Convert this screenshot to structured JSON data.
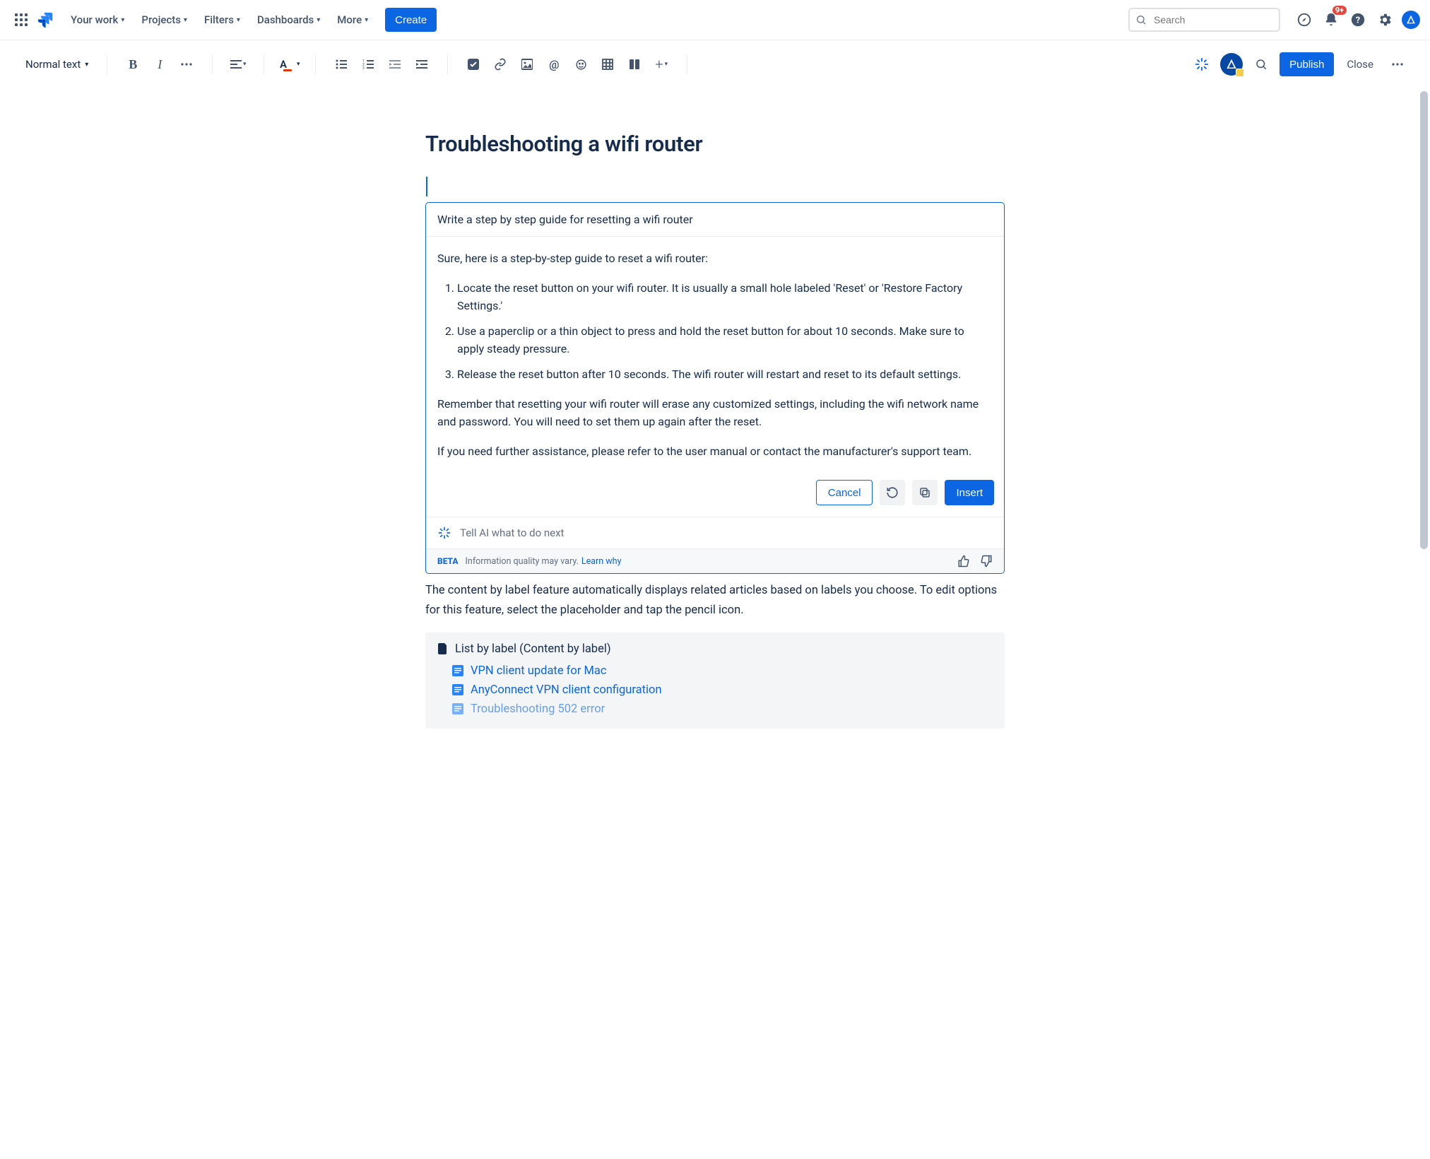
{
  "topnav": {
    "menu": [
      "Your work",
      "Projects",
      "Filters",
      "Dashboards",
      "More"
    ],
    "create": "Create",
    "search_placeholder": "Search",
    "notifications_badge": "9+"
  },
  "toolbar": {
    "text_style": "Normal text",
    "publish": "Publish",
    "close": "Close"
  },
  "doc": {
    "title": "Troubleshooting a wifi router"
  },
  "ai": {
    "prompt": "Write a step by step guide for resetting a wifi router",
    "intro": "Sure, here is a step-by-step guide to reset a wifi router:",
    "steps": [
      "Locate the reset button on your wifi router. It is usually a small hole labeled 'Reset' or 'Restore Factory Settings.'",
      "Use a paperclip or a thin object to press and hold the reset button for about 10 seconds. Make sure to apply steady pressure.",
      "Release the reset button after 10 seconds. The wifi router will restart and reset to its default settings."
    ],
    "para2": "Remember that resetting your wifi router will erase any customized settings, including the wifi network name and password. You will need to set them up again after the reset.",
    "para3": "If you need further assistance, please refer to the user manual or contact the manufacturer's support team.",
    "cancel": "Cancel",
    "insert": "Insert",
    "next_placeholder": "Tell AI what to do next",
    "beta": "BETA",
    "disclaimer": "Information quality may vary.",
    "learn_why": "Learn why"
  },
  "below": {
    "paragraph": "The content by label feature automatically displays related articles based on labels you choose. To edit options for this feature, select the placeholder and tap the pencil icon."
  },
  "label_box": {
    "title": "List by label (Content by label)",
    "items": [
      "VPN client update for Mac",
      "AnyConnect VPN client configuration",
      "Troubleshooting 502 error"
    ]
  }
}
